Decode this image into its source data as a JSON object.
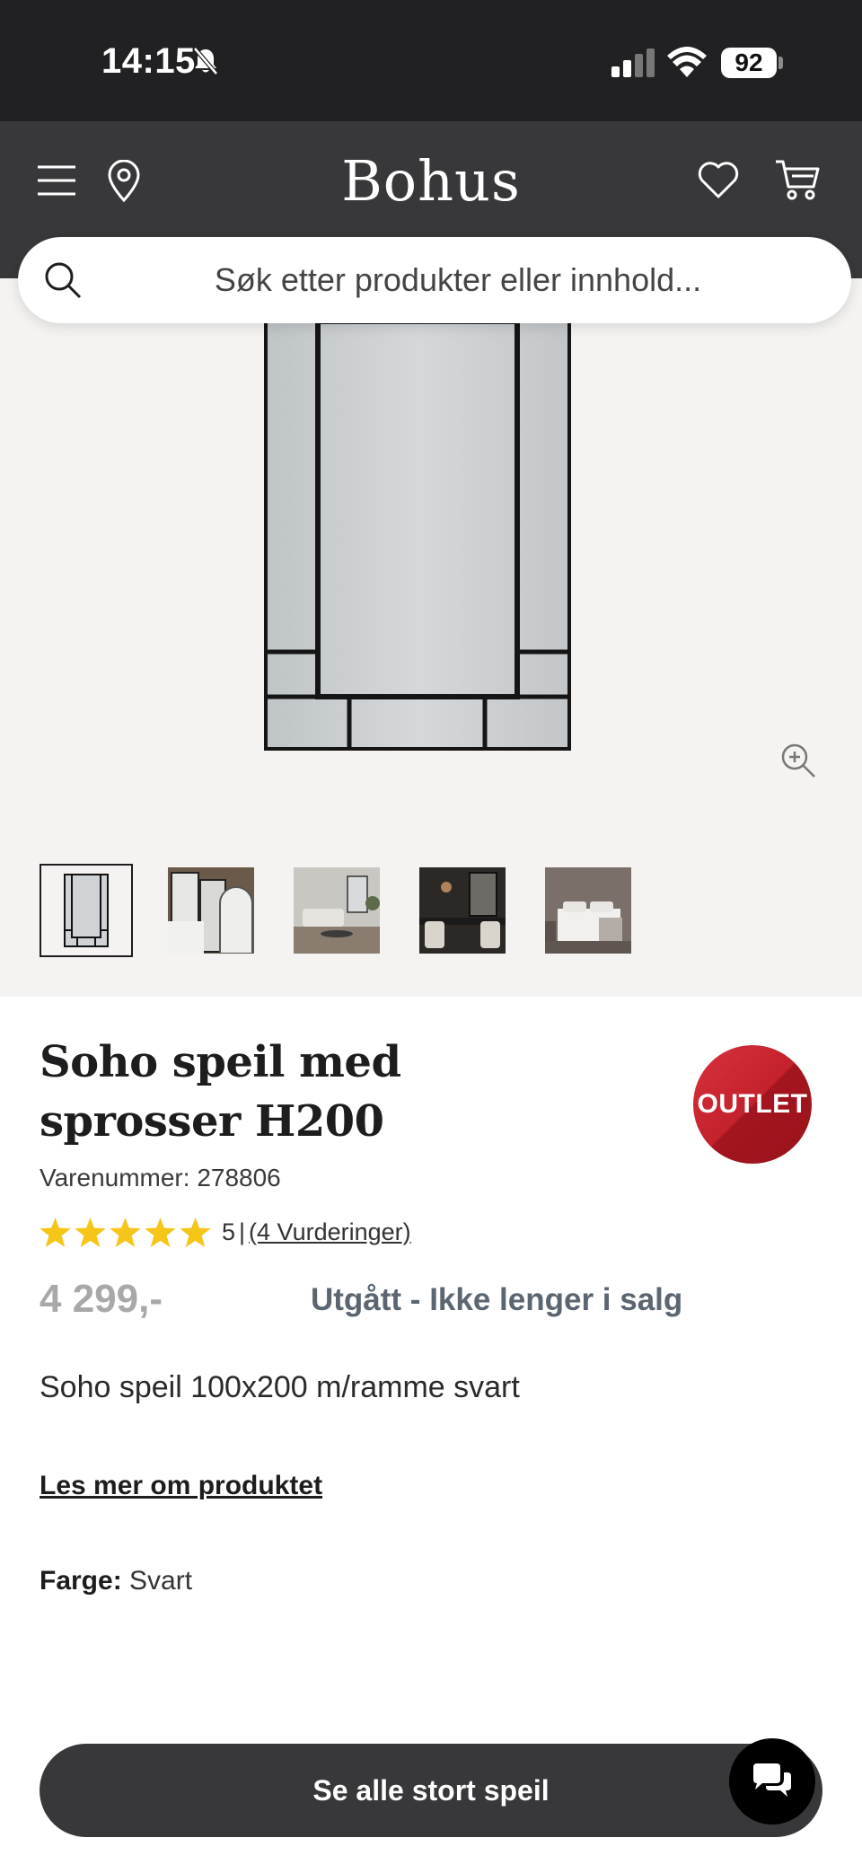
{
  "status_bar": {
    "time": "14:15",
    "battery": "92",
    "icons": [
      "bell-slash-icon",
      "signal-icon",
      "wifi-icon",
      "battery-icon"
    ]
  },
  "header": {
    "brand": "Bohus",
    "icons": [
      "menu-icon",
      "location-pin-icon",
      "heart-icon",
      "cart-icon"
    ]
  },
  "search": {
    "placeholder": "Søk etter produkter eller innhold..."
  },
  "gallery": {
    "main_image": "mirror-with-black-frame",
    "zoom_icon": "zoom-in-icon",
    "thumbnails": [
      "mirror-front",
      "mirrors-group",
      "living-room",
      "dining-room",
      "bedroom"
    ],
    "selected_index": 0
  },
  "product": {
    "title": "Soho speil med sprosser H200",
    "badge": "OUTLET",
    "sku": "Varenummer: 278806",
    "rating_value": 5,
    "rating_score": "5",
    "rating_separator": "|",
    "rating_link": "(4 Vurderinger)",
    "price": "4 299,-",
    "availability": "Utgått - Ikke lenger i salg",
    "short_description": "Soho speil 100x200 m/ramme svart",
    "read_more": "Les mer om produktet",
    "color_label": "Farge:",
    "color_value": "Svart"
  },
  "bottom": {
    "cta_label": "Se alle stort speil",
    "chat_icon": "chat-bubbles-icon"
  },
  "colors": {
    "header": "#38383b",
    "status_bar": "#212123",
    "badge": "#c3212c",
    "star": "#f5c518",
    "gallery_bg": "#f4f3f1"
  }
}
